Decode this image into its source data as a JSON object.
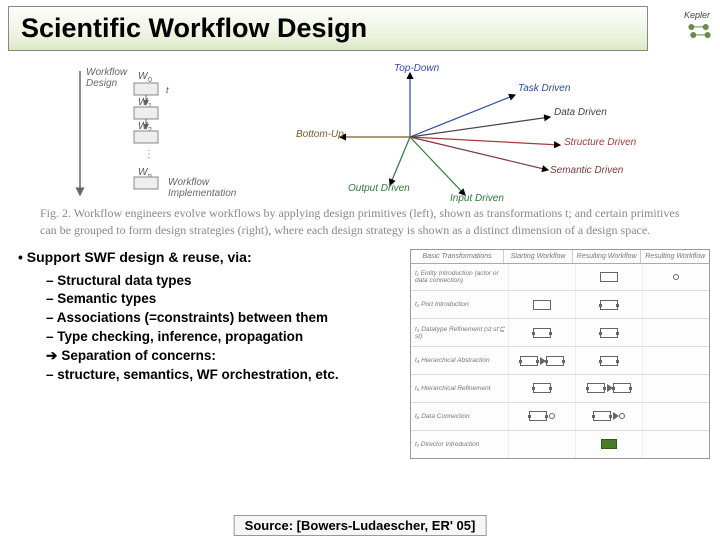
{
  "header": {
    "title": "Scientific Workflow Design",
    "logo_label": "Kepler"
  },
  "figure": {
    "left": {
      "design_label": "Workflow\nDesign",
      "impl_label": "Workflow\nImplementation",
      "w_labels": [
        "W",
        "W",
        "W",
        "W"
      ],
      "w_subs": [
        "0",
        "1",
        "2",
        "n"
      ],
      "t_label": "t"
    },
    "right": {
      "axes": {
        "top": "Top-Down",
        "bottom_up": "Bottom-Up",
        "task": "Task Driven",
        "data": "Data Driven",
        "structure": "Structure Driven",
        "semantic": "Semantic Driven",
        "output": "Output Driven",
        "input": "Input Driven"
      }
    },
    "caption": "Fig. 2. Workflow engineers evolve workflows by applying design primitives (left), shown as transformations t; and certain primitives can be grouped to form design strategies (right), where each design strategy is shown as a distinct dimension of a design space."
  },
  "bullets": {
    "main": "Support SWF design & reuse, via:",
    "items": [
      "Structural data types",
      "Semantic types",
      "Associations (=constraints) between them",
      "Type checking, inference, propagation",
      "Separation of concerns:",
      "structure, semantics, WF orchestration, etc."
    ]
  },
  "table": {
    "headers": [
      "Basic Transformations",
      "Starting Workflow",
      "Resulting Workflow",
      "Resulting Workflow"
    ],
    "rows": [
      "t₁ Entity Introduction (actor or data connection)",
      "t₂ Port Introduction",
      "t₃ Datatype Refinement (st st′⊑ st)",
      "t₄ Hierarchical Abstraction",
      "t₅ Hierarchical Refinement",
      "t₆ Data Connection",
      "t₇ Director Introduction"
    ]
  },
  "source": "Source: [Bowers-Ludaescher, ER' 05]"
}
